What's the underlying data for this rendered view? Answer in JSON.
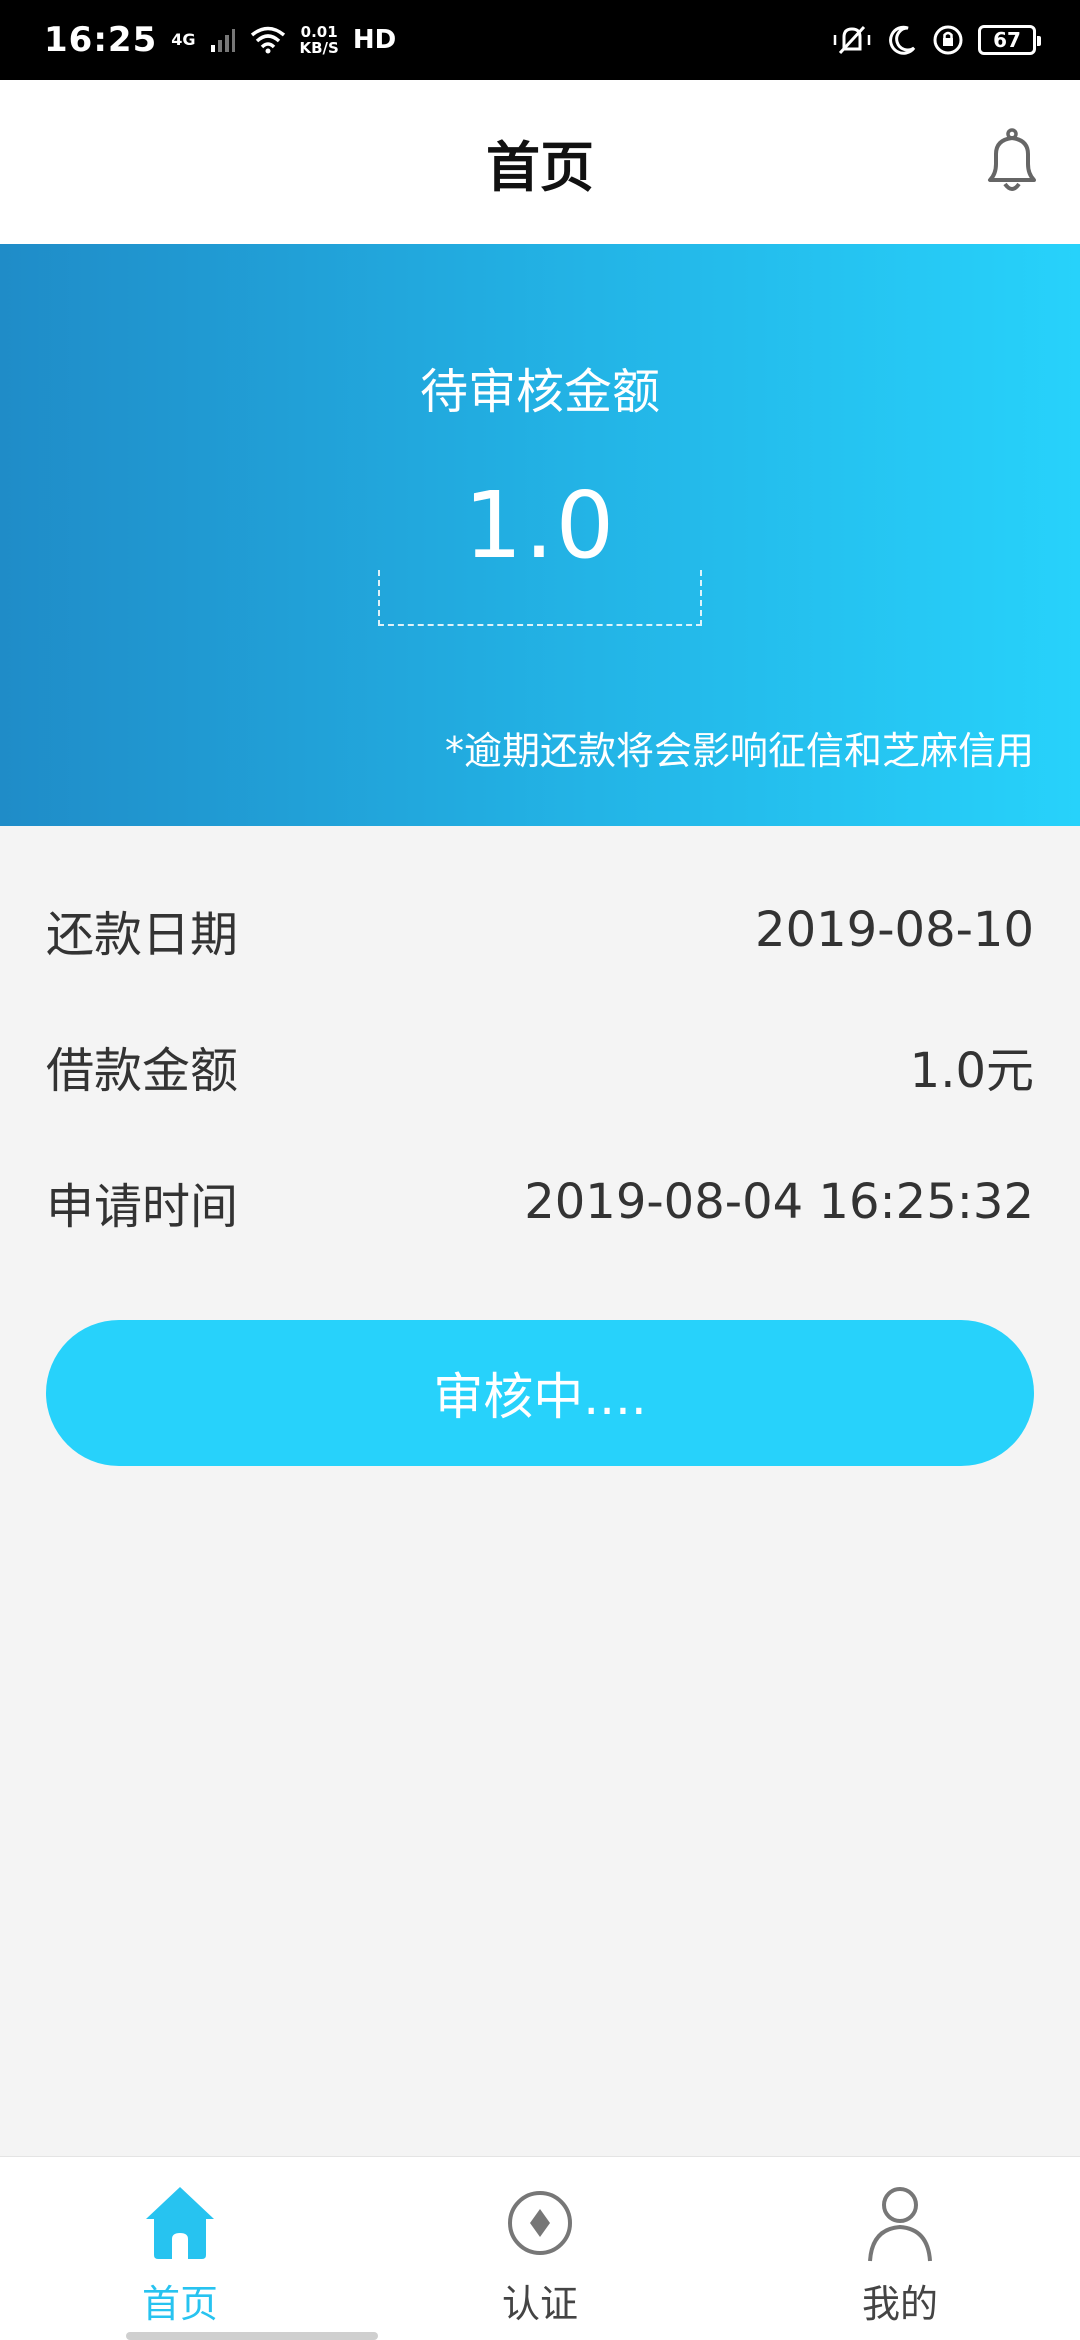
{
  "status_bar": {
    "time": "16:25",
    "network": "4G",
    "speed_value": "0.01",
    "speed_unit": "KB/S",
    "hd": "HD",
    "battery": "67"
  },
  "header": {
    "title": "首页"
  },
  "banner": {
    "label": "待审核金额",
    "amount": "1.0",
    "notice": "*逾期还款将会影响征信和芝麻信用"
  },
  "info": [
    {
      "label": "还款日期",
      "value": "2019-08-10"
    },
    {
      "label": "借款金额",
      "value": "1.0元"
    },
    {
      "label": "申请时间",
      "value": "2019-08-04 16:25:32"
    }
  ],
  "status_button": {
    "label": "审核中...."
  },
  "bottom_nav": [
    {
      "label": "首页",
      "icon": "home-icon",
      "active": true
    },
    {
      "label": "认证",
      "icon": "verify-icon",
      "active": false
    },
    {
      "label": "我的",
      "icon": "user-icon",
      "active": false
    }
  ],
  "colors": {
    "accent": "#27d2fb",
    "banner_start": "#1f8cc8",
    "banner_end": "#27d2fb"
  }
}
